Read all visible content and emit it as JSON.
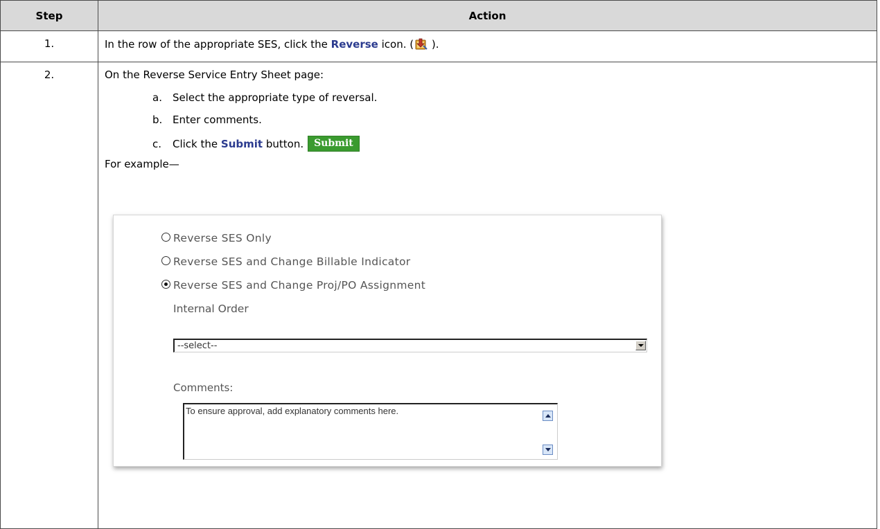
{
  "table": {
    "headers": {
      "step": "Step",
      "action": "Action"
    },
    "rows": [
      {
        "step": "1.",
        "text_before": "In the row of the appropriate SES, click the ",
        "link": "Reverse",
        "text_after": " icon. (",
        "text_close": " ).",
        "icon": "reverse-icon"
      },
      {
        "step": "2.",
        "intro": "On the Reverse Service Entry Sheet page:",
        "substeps": [
          {
            "letter": "a.",
            "text": "Select the appropriate type of reversal."
          },
          {
            "letter": "b.",
            "text": "Enter comments."
          },
          {
            "letter": "c.",
            "text_before": "Click the ",
            "link": "Submit",
            "text_after": " button.",
            "button_image": "Submit"
          }
        ],
        "example_label": "For example—"
      }
    ]
  },
  "example_screenshot": {
    "options": [
      {
        "label": "Reverse SES Only",
        "selected": false
      },
      {
        "label": "Reverse SES and Change Billable Indicator",
        "selected": false
      },
      {
        "label": "Reverse SES and Change Proj/PO Assignment",
        "selected": true
      }
    ],
    "internal_order_label": "Internal Order",
    "internal_order_value": "--select--",
    "comments_label": "Comments:",
    "comments_value": "To ensure approval, add explanatory comments here."
  }
}
